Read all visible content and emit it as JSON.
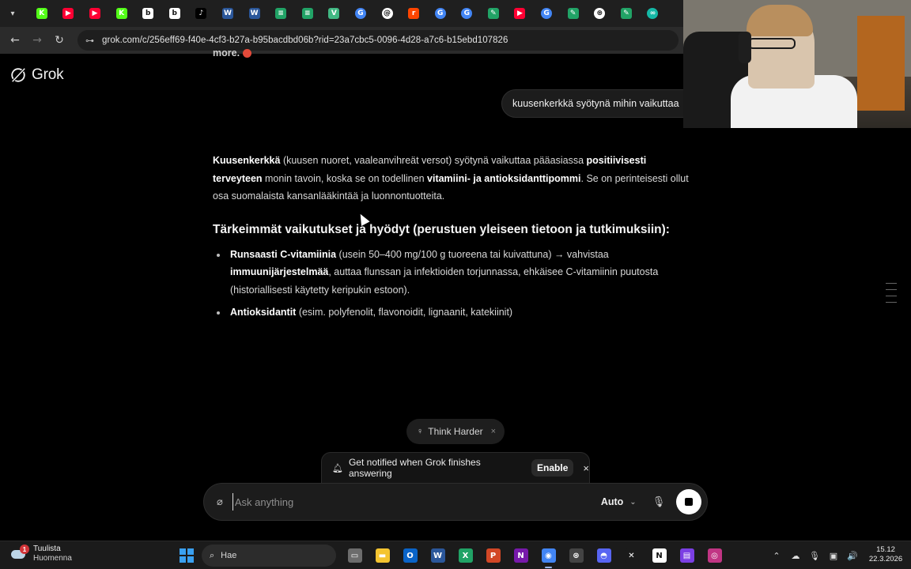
{
  "browser": {
    "tab_dropdown_icon": "chevron-down-icon",
    "tabs": [
      {
        "icon": "kick",
        "color": "#53fc18",
        "glyph": "K"
      },
      {
        "icon": "youtube",
        "color": "#ff0033",
        "glyph": "▶"
      },
      {
        "icon": "youtube",
        "color": "#ff0033",
        "glyph": "▶"
      },
      {
        "icon": "kick",
        "color": "#53fc18",
        "glyph": "K"
      },
      {
        "icon": "b-app",
        "color": "#ffffff",
        "glyph": "b"
      },
      {
        "icon": "b-app",
        "color": "#ffffff",
        "glyph": "b"
      },
      {
        "icon": "tiktok",
        "color": "#000000",
        "glyph": "♪"
      },
      {
        "icon": "word",
        "color": "#2b579a",
        "glyph": "W"
      },
      {
        "icon": "word",
        "color": "#2b579a",
        "glyph": "W"
      },
      {
        "icon": "sheets",
        "color": "#21a366",
        "glyph": "≡"
      },
      {
        "icon": "sheets",
        "color": "#21a366",
        "glyph": "≡"
      },
      {
        "icon": "vue",
        "color": "#41b883",
        "glyph": "V"
      },
      {
        "icon": "google",
        "color": "#4285f4",
        "glyph": "G"
      },
      {
        "icon": "threads",
        "color": "#ffffff",
        "glyph": "@"
      },
      {
        "icon": "reddit",
        "color": "#ff4500",
        "glyph": "r"
      },
      {
        "icon": "google",
        "color": "#4285f4",
        "glyph": "G"
      },
      {
        "icon": "google",
        "color": "#4285f4",
        "glyph": "G"
      },
      {
        "icon": "leaf",
        "color": "#21a366",
        "glyph": "✎"
      },
      {
        "icon": "youtube",
        "color": "#ff0033",
        "glyph": "▶"
      },
      {
        "icon": "google",
        "color": "#4285f4",
        "glyph": "G"
      },
      {
        "icon": "leaf",
        "color": "#21a366",
        "glyph": "✎"
      },
      {
        "icon": "openai",
        "color": "#ffffff",
        "glyph": "⊛"
      },
      {
        "icon": "leaf",
        "color": "#21a366",
        "glyph": "✎"
      },
      {
        "icon": "copilot",
        "color": "#14b8a6",
        "glyph": "∞"
      }
    ],
    "back_icon": "←",
    "forward_icon": "→",
    "reload_icon": "↻",
    "site_settings_icon": "⊶",
    "url": "grok.com/c/256eff69-f40e-4cf3-b27a-b95bacdbd06b?rid=23a7cbc5-0096-4d28-a7c6-b15ebd107826"
  },
  "app": {
    "logo_text": "Grok",
    "previous_message_fragment": "more.",
    "user_message": "kuusenkerkkä syötynä mihin vaikuttaa",
    "answer": {
      "intro": {
        "b1": "Kuusenkerkkä",
        "t1": " (kuusen nuoret, vaaleanvihreät versot) syötynä vaikuttaa pääasiassa ",
        "b2": "positiivisesti terveyteen",
        "t2": " monin tavoin, koska se on todellinen ",
        "b3": "vitamiini- ja antioksidanttipommi",
        "t3": ". Se on perinteisesti ollut osa suomalaista kansanlääkintää ja luonnontuotteita."
      },
      "heading": "Tärkeimmät vaikutukset ja hyödyt (perustuen yleiseen tietoon ja tutkimuksiin):",
      "bullets": [
        {
          "b1": "Runsaasti C-vitamiinia",
          "t1": " (usein 50–400 mg/100 g tuoreena tai kuivattuna) → vahvistaa ",
          "b2": "immuunijärjestelmää",
          "t2": ", auttaa flunssan ja infektioiden torjunnassa, ehkäisee C-vitamiinin puutosta (historiallisesti käytetty keripukin estoon)."
        },
        {
          "b1": "Antioksidantit",
          "t1": " (esim. polyfenolit, flavonoidit, lignaanit, katekiinit)"
        }
      ]
    },
    "think_harder": {
      "label": "Think Harder",
      "icon": "lightbulb-icon",
      "close": "×"
    },
    "notification": {
      "icon": "bell-icon",
      "message": "Get notified when Grok finishes answering",
      "enable_label": "Enable",
      "close": "×"
    },
    "composer": {
      "placeholder": "Ask anything",
      "value": "",
      "model_label": "Auto",
      "attach_icon": "paperclip-icon",
      "mic_icon": "microphone-icon",
      "stop_icon": "stop-icon"
    }
  },
  "taskbar": {
    "weather": {
      "line1": "Tuulista",
      "line2": "Huomenna",
      "badge": "1"
    },
    "search_label": "Hae",
    "apps": [
      {
        "name": "task-view",
        "color": "#6c6c6c",
        "glyph": "▭"
      },
      {
        "name": "file-explorer",
        "color": "#f4c430",
        "glyph": "▬"
      },
      {
        "name": "outlook",
        "color": "#0a64c8",
        "glyph": "O"
      },
      {
        "name": "word",
        "color": "#2b579a",
        "glyph": "W"
      },
      {
        "name": "excel",
        "color": "#21a366",
        "glyph": "X"
      },
      {
        "name": "powerpoint",
        "color": "#d24726",
        "glyph": "P"
      },
      {
        "name": "onenote",
        "color": "#7719aa",
        "glyph": "N"
      },
      {
        "name": "chrome",
        "color": "#4285f4",
        "glyph": "◉",
        "active": true
      },
      {
        "name": "chatgpt",
        "color": "#444444",
        "glyph": "⊛"
      },
      {
        "name": "discord",
        "color": "#5865f2",
        "glyph": "◓"
      },
      {
        "name": "capcut",
        "color": "#1b1b1b",
        "glyph": "✕"
      },
      {
        "name": "notion",
        "color": "#ffffff",
        "glyph": "N"
      },
      {
        "name": "clipchamp",
        "color": "#7b3fe4",
        "glyph": "▤"
      },
      {
        "name": "instagram",
        "color": "#c13584",
        "glyph": "◎"
      }
    ],
    "tray": {
      "chevron_icon": "⌃",
      "icons": [
        "☁",
        "🎙",
        "▣",
        "🔊"
      ]
    },
    "clock": {
      "time": "15.12",
      "date": "22.3.2026"
    }
  }
}
